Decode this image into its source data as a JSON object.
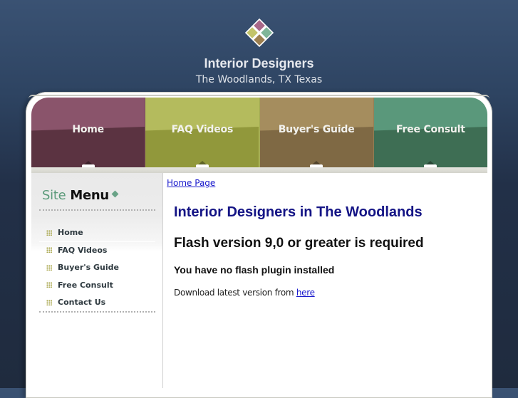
{
  "header": {
    "logo_icon": "four-diamond-tiles-logo",
    "logo_colors": [
      "#a86889",
      "#c3c46a",
      "#7fb598",
      "#9c7f4f"
    ],
    "title": "Interior Designers",
    "subtitle": "The Woodlands, TX Texas"
  },
  "nav": {
    "items": [
      {
        "label": "Home",
        "color": "#8a546b"
      },
      {
        "label": "FAQ Videos",
        "color": "#b4bb5d"
      },
      {
        "label": "Buyer's Guide",
        "color": "#a58d5e"
      },
      {
        "label": "Free Consult",
        "color": "#5a987b"
      }
    ]
  },
  "sidebar": {
    "title_part1": "Site",
    "title_part2": "Menu",
    "items": [
      {
        "label": "Home"
      },
      {
        "label": "FAQ Videos"
      },
      {
        "label": "Buyer's Guide"
      },
      {
        "label": "Free Consult"
      },
      {
        "label": "Contact Us"
      }
    ]
  },
  "content": {
    "breadcrumb": "Home Page",
    "heading": "Interior Designers in The Woodlands",
    "flash_required": "Flash version 9,0 or greater is required",
    "no_plugin": "You have no flash plugin installed",
    "download_text": "Download latest version from",
    "download_link": "here"
  }
}
